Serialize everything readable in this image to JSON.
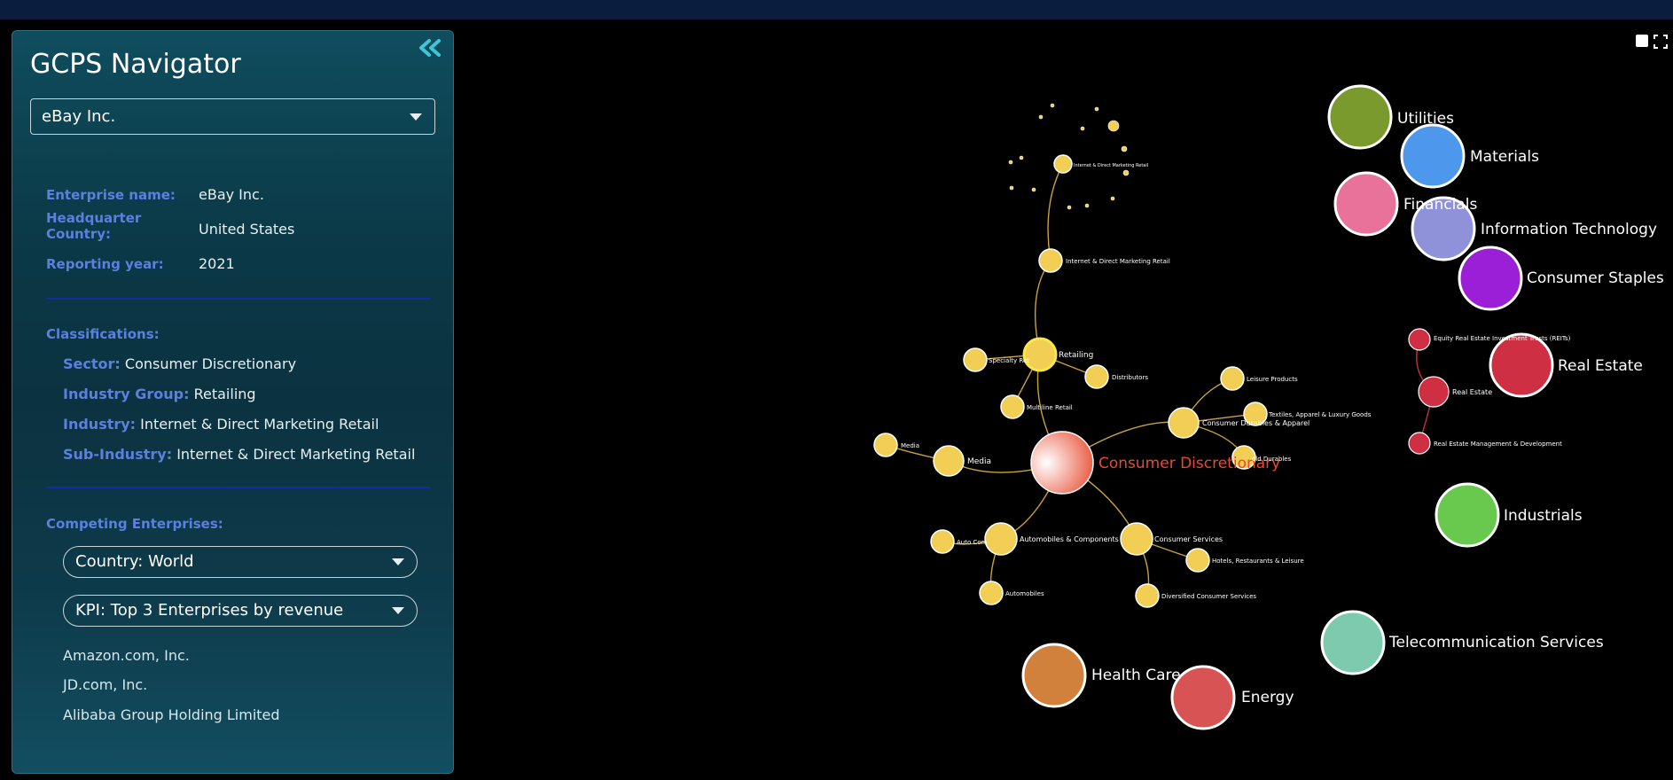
{
  "app": {
    "title": "GCPS Navigator"
  },
  "enterprise_select": {
    "value": "eBay Inc."
  },
  "info": {
    "enterprise_label": "Enterprise name:",
    "enterprise_value": "eBay Inc.",
    "hq_label_1": "Headquarter",
    "hq_label_2": "Country:",
    "hq_value": "United States",
    "year_label": "Reporting year:",
    "year_value": "2021"
  },
  "classifications": {
    "heading": "Classifications:",
    "sector_label": "Sector:",
    "sector_value": "Consumer Discretionary",
    "group_label": "Industry Group:",
    "group_value": "Retailing",
    "industry_label": "Industry:",
    "industry_value": "Internet & Direct Marketing Retail",
    "subindustry_label": "Sub-Industry:",
    "subindustry_value": "Internet & Direct Marketing Retail"
  },
  "competing": {
    "heading": "Competing Enterprises:",
    "country_select": "Country: World",
    "kpi_select": "KPI: Top 3 Enterprises by revenue",
    "enterprises": [
      "Amazon.com, Inc.",
      "JD.com, Inc.",
      "Alibaba Group Holding Limited"
    ]
  },
  "graph": {
    "sectors": [
      {
        "name": "Utilities",
        "color": "#7a9a2e"
      },
      {
        "name": "Materials",
        "color": "#4d98ec"
      },
      {
        "name": "Financials",
        "color": "#e8729a"
      },
      {
        "name": "Information Technology",
        "color": "#8f92d8"
      },
      {
        "name": "Consumer Staples",
        "color": "#9b1fd6"
      },
      {
        "name": "Real Estate",
        "color": "#cf2f42"
      },
      {
        "name": "Industrials",
        "color": "#69c84e"
      },
      {
        "name": "Telecommunication Services",
        "color": "#7ecaae"
      },
      {
        "name": "Health Care",
        "color": "#d2813c"
      },
      {
        "name": "Energy",
        "color": "#d85353"
      }
    ],
    "center": {
      "name": "Consumer Discretionary",
      "color": "#e84a2f"
    },
    "groups": {
      "retailing": "Retailing",
      "media": "Media",
      "consumer_durables": "Consumer Durables & Apparel",
      "consumer_services": "Consumer Services",
      "automobiles": "Automobiles & Components"
    },
    "industries": {
      "internet_retail": "Internet & Direct Marketing Retail",
      "specialty_retail": "Specialty Ret",
      "distributors": "Distributors",
      "multiline_retail": "Multiline Retail",
      "media": "Media",
      "leisure": "Leisure Products",
      "textiles": "Textiles, Apparel & Luxury Goods",
      "household_durables": "old Durables",
      "hotels": "Hotels, Restaurants & Leisure",
      "diversified_services": "Diversified Consumer Services",
      "auto_components": "Auto Com",
      "automobiles": "Automobiles",
      "subindustry": "Internet & Direct Marketing Retail"
    },
    "real_estate_children": {
      "reits": "Equity Real Estate Investment Trusts (REITs)",
      "group": "Real Estate",
      "management": "Real Estate Management & Development"
    },
    "accent_yellow": "#f2ce55"
  }
}
